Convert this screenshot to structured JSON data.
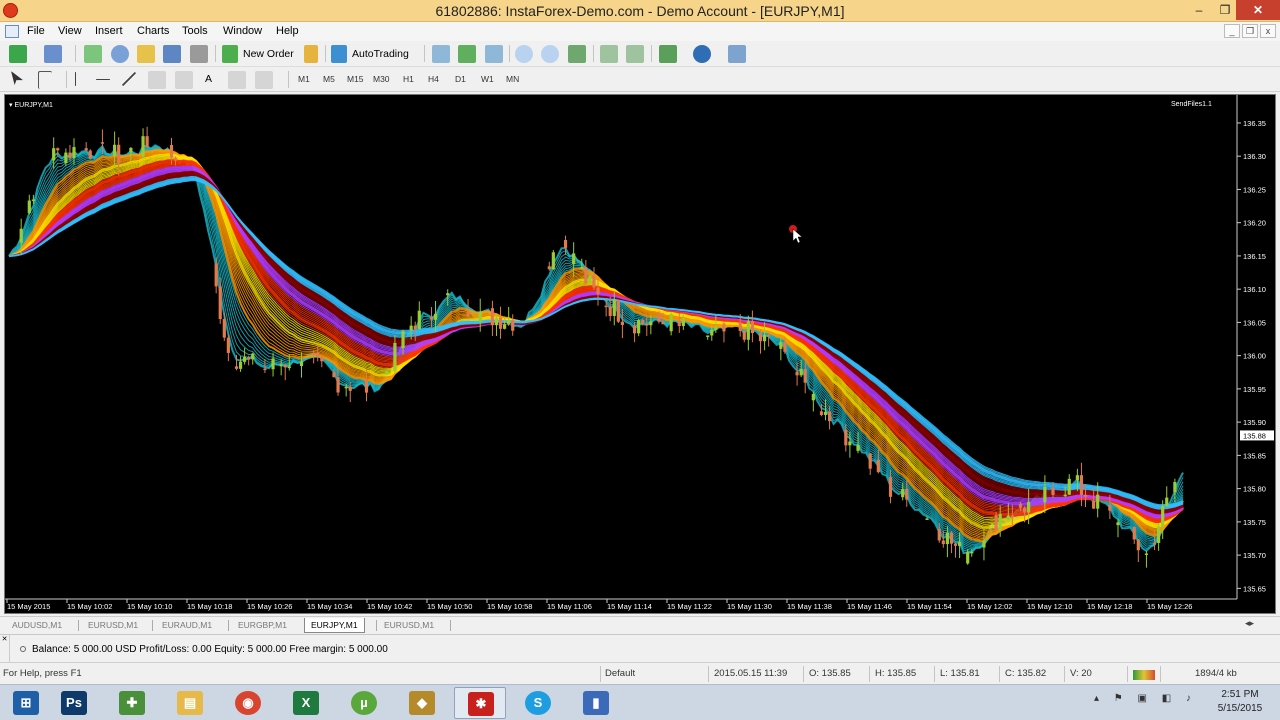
{
  "window": {
    "title": "61802886: InstaForex-Demo.com - Demo Account - [EURJPY,M1]",
    "controls": {
      "minimize": "‒",
      "maximize": "❐",
      "close": "✕"
    }
  },
  "menu": [
    "File",
    "View",
    "Insert",
    "Charts",
    "Tools",
    "Window",
    "Help"
  ],
  "toolbar": {
    "new_order": "New Order",
    "auto_trading": "AutoTrading",
    "timeframes": [
      "M1",
      "M5",
      "M15",
      "M30",
      "H1",
      "H4",
      "D1",
      "W1",
      "MN"
    ],
    "search_placeholder": ""
  },
  "chart": {
    "symbol_label": "EURJPY,M1",
    "indicator_label": "SendFiles1.1",
    "current_price": "135.88",
    "price_axis": [
      "136.35",
      "136.30",
      "136.25",
      "136.20",
      "136.15",
      "136.10",
      "136.05",
      "136.00",
      "135.95",
      "135.90",
      "135.85",
      "135.80",
      "135.75",
      "135.70",
      "135.65"
    ],
    "time_axis": [
      "15 May 2015",
      "15 May 10:02",
      "15 May 10:10",
      "15 May 10:18",
      "15 May 10:26",
      "15 May 10:34",
      "15 May 10:42",
      "15 May 10:50",
      "15 May 10:58",
      "15 May 11:06",
      "15 May 11:14",
      "15 May 11:22",
      "15 May 11:30",
      "15 May 11:38",
      "15 May 11:46",
      "15 May 11:54",
      "15 May 12:02",
      "15 May 12:10",
      "15 May 12:18",
      "15 May 12:26"
    ],
    "colors": {
      "background": "#000000",
      "bull": "#9acd32",
      "bear": "#e07a4f",
      "ribbon": [
        "#18b4c4",
        "#ff9900",
        "#ffe000",
        "#ff3300",
        "#b43cff",
        "#8b0000",
        "#30c0ff"
      ]
    }
  },
  "chart_data": {
    "type": "candlestick",
    "symbol": "EURJPY",
    "timeframe": "M1",
    "ylim": [
      135.64,
      136.38
    ],
    "close_approx": [
      136.15,
      136.3,
      136.31,
      136.3,
      136.32,
      136.28,
      136.0,
      135.98,
      136.0,
      135.96,
      135.95,
      136.05,
      136.09,
      136.06,
      136.05,
      136.18,
      136.09,
      136.05,
      136.05,
      136.03,
      136.04,
      136.01,
      135.93,
      135.87,
      135.8,
      135.76,
      135.7,
      135.76,
      135.78,
      135.81,
      135.76,
      135.7,
      135.84
    ]
  },
  "tabs": [
    "AUDUSD,M1",
    "EURUSD,M1",
    "EURAUD,M1",
    "EURGBP,M1",
    "EURJPY,M1",
    "EURUSD,M1"
  ],
  "terminal": {
    "side_label": "✕",
    "balance_text": "Balance: 5 000.00 USD  Profit/Loss: 0.00  Equity: 5 000.00  Free margin: 5 000.00"
  },
  "status": {
    "help": "For Help, press F1",
    "profile": "Default",
    "datetime": "2015.05.15 11:39",
    "open": "O: 135.85",
    "high": "H: 135.85",
    "low": "L: 135.81",
    "close": "C: 135.82",
    "volume": "V: 20",
    "traffic": "1894/4 kb"
  },
  "taskbar": {
    "apps": [
      {
        "name": "windows-start",
        "glyph": "⊞",
        "color": "#1f5fa8"
      },
      {
        "name": "photoshop",
        "glyph": "Ps",
        "color": "#0e3a6b"
      },
      {
        "name": "camtasia",
        "glyph": "✚",
        "color": "#4a8f3a"
      },
      {
        "name": "file-explorer",
        "glyph": "▤",
        "color": "#e7b94a"
      },
      {
        "name": "chrome",
        "glyph": "◉",
        "color": "#d9442e"
      },
      {
        "name": "excel",
        "glyph": "X",
        "color": "#1f7a3f"
      },
      {
        "name": "utorrent",
        "glyph": "µ",
        "color": "#5aa83c"
      },
      {
        "name": "winrar",
        "glyph": "◆",
        "color": "#b48a2a"
      },
      {
        "name": "metatrader",
        "glyph": "✱",
        "color": "#c8201d"
      },
      {
        "name": "skype",
        "glyph": "S",
        "color": "#1e9ee0"
      },
      {
        "name": "save-app",
        "glyph": "▮",
        "color": "#3a6ab8"
      }
    ],
    "tray": "▴ ⚑ ▣ ◧ ♪",
    "time": "2:51 PM",
    "date": "5/15/2015"
  }
}
